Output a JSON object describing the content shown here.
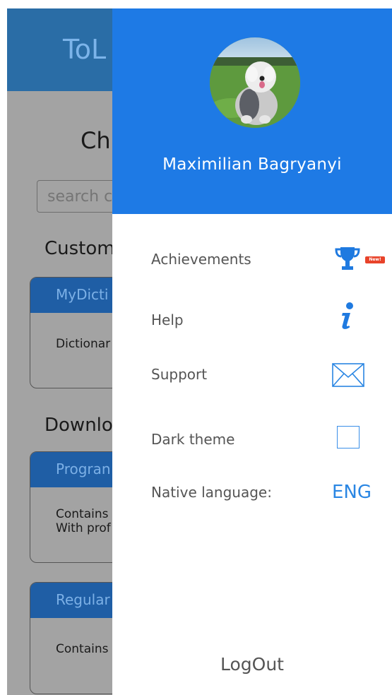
{
  "background": {
    "app_title": "ToL",
    "heading": "Ch",
    "search_placeholder": "search c",
    "sections": [
      {
        "title": "Custom"
      },
      {
        "title": "Downlo"
      }
    ],
    "cards": [
      {
        "title": "MyDicti",
        "line1": "Dictionar",
        "line2": ""
      },
      {
        "title": "Progran",
        "line1": "Contains",
        "line2": "With prof"
      },
      {
        "title": "Regular",
        "line1": "Contains",
        "line2": ""
      }
    ]
  },
  "drawer": {
    "user_name": "Maximilian Bagryanyi",
    "menu": {
      "achievements": "Achievements",
      "help": "Help",
      "support": "Support",
      "dark_theme": "Dark theme",
      "native_language": "Native language:"
    },
    "badge": "New!",
    "language_value": "ENG",
    "dark_theme_checked": false,
    "logout": "LogOut"
  },
  "colors": {
    "accent": "#1e7ae5",
    "icon_blue": "#2a86e3",
    "badge_red": "#e8432a"
  }
}
